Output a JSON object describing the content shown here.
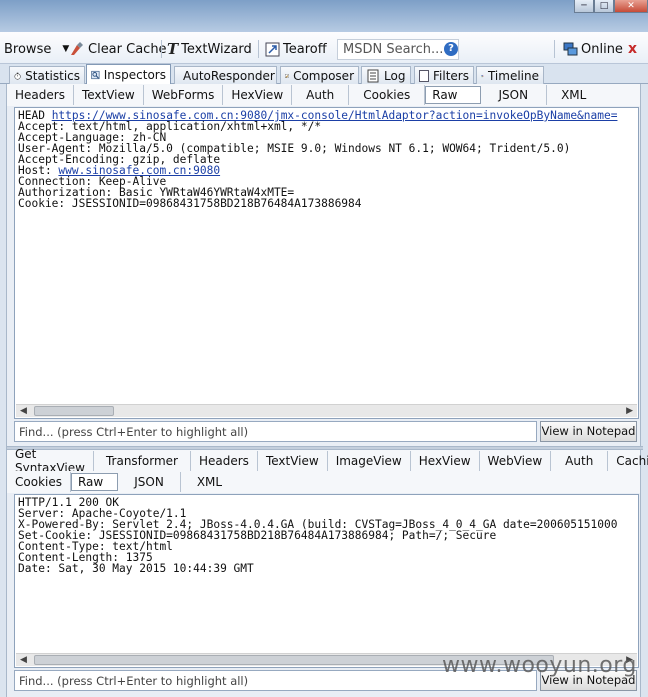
{
  "window": {
    "min_label": "─",
    "max_label": "□",
    "close_label": "✕"
  },
  "toolbar": {
    "browse": "Browse",
    "clear_cache": "Clear Cache",
    "text_wizard": "TextWizard",
    "tearoff": "Tearoff",
    "search_placeholder": "MSDN Search...",
    "online": "Online",
    "close_x": "x"
  },
  "tabs": [
    "Statistics",
    "Inspectors",
    "AutoResponder",
    "Composer",
    "Log",
    "Filters",
    "Timeline"
  ],
  "request": {
    "subtabs": [
      "Headers",
      "TextView",
      "WebForms",
      "HexView",
      "Auth",
      "Cookies",
      "Raw",
      "JSON",
      "XML"
    ],
    "method": "HEAD ",
    "url": "https://www.sinosafe.com.cn:9080/jmx-console/HtmlAdaptor?action=invokeOpByName&name=",
    "lines_before_host": [
      "Accept: text/html, application/xhtml+xml, */*",
      "Accept-Language: zh-CN",
      "User-Agent: Mozilla/5.0 (compatible; MSIE 9.0; Windows NT 6.1; WOW64; Trident/5.0)",
      "Accept-Encoding: gzip, deflate"
    ],
    "host_label": "Host: ",
    "host_link": "www.sinosafe.com.cn:9080",
    "lines_after_host": [
      "Connection: Keep-Alive",
      "Authorization: Basic YWRtaW46YWRtaW4xMTE=",
      "Cookie: JSESSIONID=09868431758BD218B76484A173886984"
    ],
    "find_placeholder": "Find... (press Ctrl+Enter to highlight all)",
    "notepad_label": "View in Notepad"
  },
  "response": {
    "subtabs_row1": [
      "Get SyntaxView",
      "Transformer",
      "Headers",
      "TextView",
      "ImageView",
      "HexView",
      "WebView",
      "Auth",
      "Caching"
    ],
    "subtabs_row2": [
      "Cookies",
      "Raw",
      "JSON",
      "XML"
    ],
    "lines": [
      "HTTP/1.1 200 OK",
      "Server: Apache-Coyote/1.1",
      "X-Powered-By: Servlet 2.4; JBoss-4.0.4.GA (build: CVSTag=JBoss_4_0_4_GA date=200605151000",
      "Set-Cookie: JSESSIONID=09868431758BD218B76484A173886984; Path=/; Secure",
      "Content-Type: text/html",
      "Content-Length: 1375",
      "Date: Sat, 30 May 2015 10:44:39 GMT"
    ],
    "find_placeholder": "Find... (press Ctrl+Enter to highlight all)",
    "notepad_label": "View in Notepad"
  },
  "watermark": "www.wooyun.org"
}
